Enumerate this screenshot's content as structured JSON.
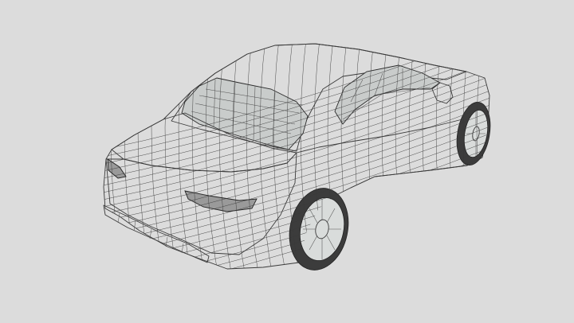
{
  "scene": {
    "background_color": "#dcdcdc",
    "body_fill_color": "#dde0df",
    "wire_color": "#3a3a3a",
    "subject": "wireframe-car-rear-three-quarter"
  }
}
